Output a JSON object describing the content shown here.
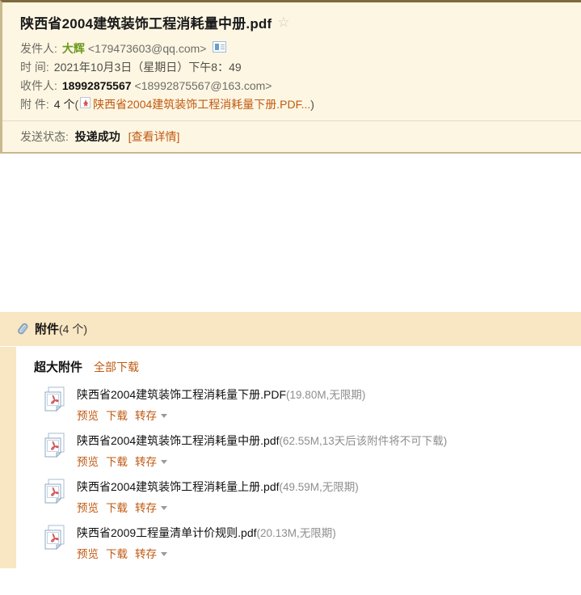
{
  "mail": {
    "subject": "陕西省2004建筑装饰工程消耗量中册.pdf",
    "star_icon": "star-outline-icon",
    "sender": {
      "label": "发件人:",
      "name": "大辉",
      "address": "<179473603@qq.com>",
      "card_icon": "contact-card-icon"
    },
    "time": {
      "label": "时 间:",
      "value": "2021年10月3日（星期日）下午8：49"
    },
    "recipient": {
      "label": "收件人:",
      "name": "18992875567",
      "address": "<18992875567@163.com>"
    },
    "attachment_meta": {
      "label": "附 件:",
      "count": "4 个",
      "open_paren": "(",
      "icon": "pdf-file-icon",
      "first_name": "陕西省2004建筑装饰工程消耗量下册.PDF...",
      "close_paren": ")"
    },
    "status": {
      "label": "发送状态:",
      "value": "投递成功",
      "detail_link": "[查看详情]"
    }
  },
  "attachments_panel": {
    "paperclip_icon": "paperclip-icon",
    "title": "附件",
    "count_text": "(4 个)",
    "bigfile_label": "超大附件",
    "download_all_label": "全部下载",
    "actions": {
      "preview": "预览",
      "download": "下载",
      "save": "转存",
      "caret_icon": "chevron-down-icon"
    },
    "items": [
      {
        "icon": "pdf-file-icon",
        "name": "陕西省2004建筑装饰工程消耗量下册.PDF",
        "meta": "(19.80M,无限期)"
      },
      {
        "icon": "pdf-file-icon",
        "name": "陕西省2004建筑装饰工程消耗量中册.pdf",
        "meta": "(62.55M,13天后该附件将不可下载)"
      },
      {
        "icon": "pdf-file-icon",
        "name": "陕西省2004建筑装饰工程消耗量上册.pdf",
        "meta": "(49.59M,无限期)"
      },
      {
        "icon": "pdf-file-icon",
        "name": "陕西省2009工程量清单计价规则.pdf",
        "meta": "(20.13M,无限期)"
      }
    ]
  },
  "colors": {
    "panel_bg": "#fdf6e3",
    "attach_header_bg": "#f9e6c2",
    "link_orange": "#c05a12",
    "sender_green": "#6a9a1f",
    "meta_gray": "#8e8e8e"
  }
}
